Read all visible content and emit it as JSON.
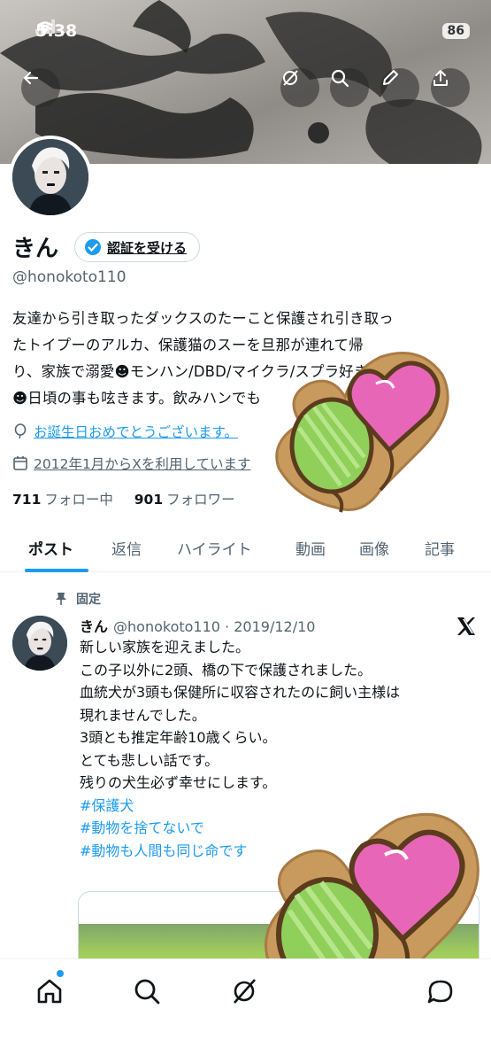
{
  "status_bar": {
    "time": "5:38",
    "battery": "86"
  },
  "profile": {
    "name": "きん",
    "verify_label": "認証を受ける",
    "handle": "@honokoto110",
    "bio_lines": [
      "友達から引き取ったダックスのたーこと保護され引き取っ",
      "たトイプーのアルカ、保護猫のスーを旦那が連れて帰",
      "り、家族で溺愛☻モンハン/DBD/マイクラ/スプラ好き",
      "☻日頃の事も呟きます。飲みハンでも"
    ],
    "birthday": "お誕生日おめでとうございます。",
    "joined": "2012年1月からXを利用しています",
    "following_count": "711",
    "following_label": "フォロー中",
    "followers_count": "901",
    "followers_label": "フォロワー"
  },
  "tabs": [
    "ポスト",
    "返信",
    "ハイライト",
    "動画",
    "画像",
    "記事"
  ],
  "tweet": {
    "pinned_label": "固定",
    "author": "きん",
    "handle_date": "@honokoto110 · 2019/12/10",
    "lines": [
      "新しい家族を迎えました。",
      "この子以外に2頭、橋の下で保護されました。",
      "血統犬が3頭も保健所に収容されたのに飼い主様は",
      "現れませんでした。",
      "3頭とも推定年齢10歳くらい。",
      "とても悲しい話です。",
      "残りの犬生必ず幸せにします。"
    ],
    "hashtags": [
      "#保護犬",
      "#動物を捨てないで",
      "#動物も人間も同じ命です"
    ]
  },
  "colors": {
    "accent": "#1d9bf0",
    "balloon_pink": "#e866b8",
    "balloon_green": "#8fcf5a",
    "sticker_wood": "#c99a5e"
  }
}
